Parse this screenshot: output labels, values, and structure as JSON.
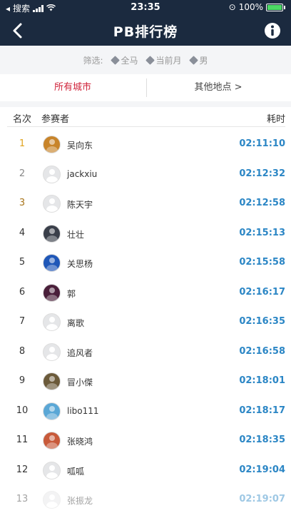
{
  "status_bar": {
    "carrier": "搜索",
    "time": "23:35",
    "battery": "100%"
  },
  "nav": {
    "title": "PB排行榜",
    "back_icon": "chevron-left-icon",
    "info_icon": "info-icon"
  },
  "filter": {
    "label": "筛选:",
    "tags": [
      "全马",
      "当前月",
      "男"
    ]
  },
  "tabs": {
    "all_cities": "所有城市",
    "other_places": "其他地点 >"
  },
  "table": {
    "headers": {
      "rank": "名次",
      "participant": "参赛者",
      "time": "耗时"
    },
    "rows": [
      {
        "rank": "1",
        "name": "吴向东",
        "time": "02:11:10"
      },
      {
        "rank": "2",
        "name": "jackxiu",
        "time": "02:12:32"
      },
      {
        "rank": "3",
        "name": "陈天宇",
        "time": "02:12:58"
      },
      {
        "rank": "4",
        "name": "壮壮",
        "time": "02:15:13"
      },
      {
        "rank": "5",
        "name": "关思杨",
        "time": "02:15:58"
      },
      {
        "rank": "6",
        "name": "郭",
        "time": "02:16:17"
      },
      {
        "rank": "7",
        "name": "离歌",
        "time": "02:16:35"
      },
      {
        "rank": "8",
        "name": "追风者",
        "time": "02:16:58"
      },
      {
        "rank": "9",
        "name": "冒小傑",
        "time": "02:18:01"
      },
      {
        "rank": "10",
        "name": "libo111",
        "time": "02:18:17"
      },
      {
        "rank": "11",
        "name": "张晓鸿",
        "time": "02:18:35"
      },
      {
        "rank": "12",
        "name": "呱呱",
        "time": "02:19:04"
      },
      {
        "rank": "13",
        "name": "张振龙",
        "time": "02:19:07"
      }
    ]
  },
  "colors": {
    "nav_bg": "#1b2a3f",
    "active_tab": "#d0243b",
    "time_text": "#2b86c5",
    "gold": "#e0a31f"
  }
}
